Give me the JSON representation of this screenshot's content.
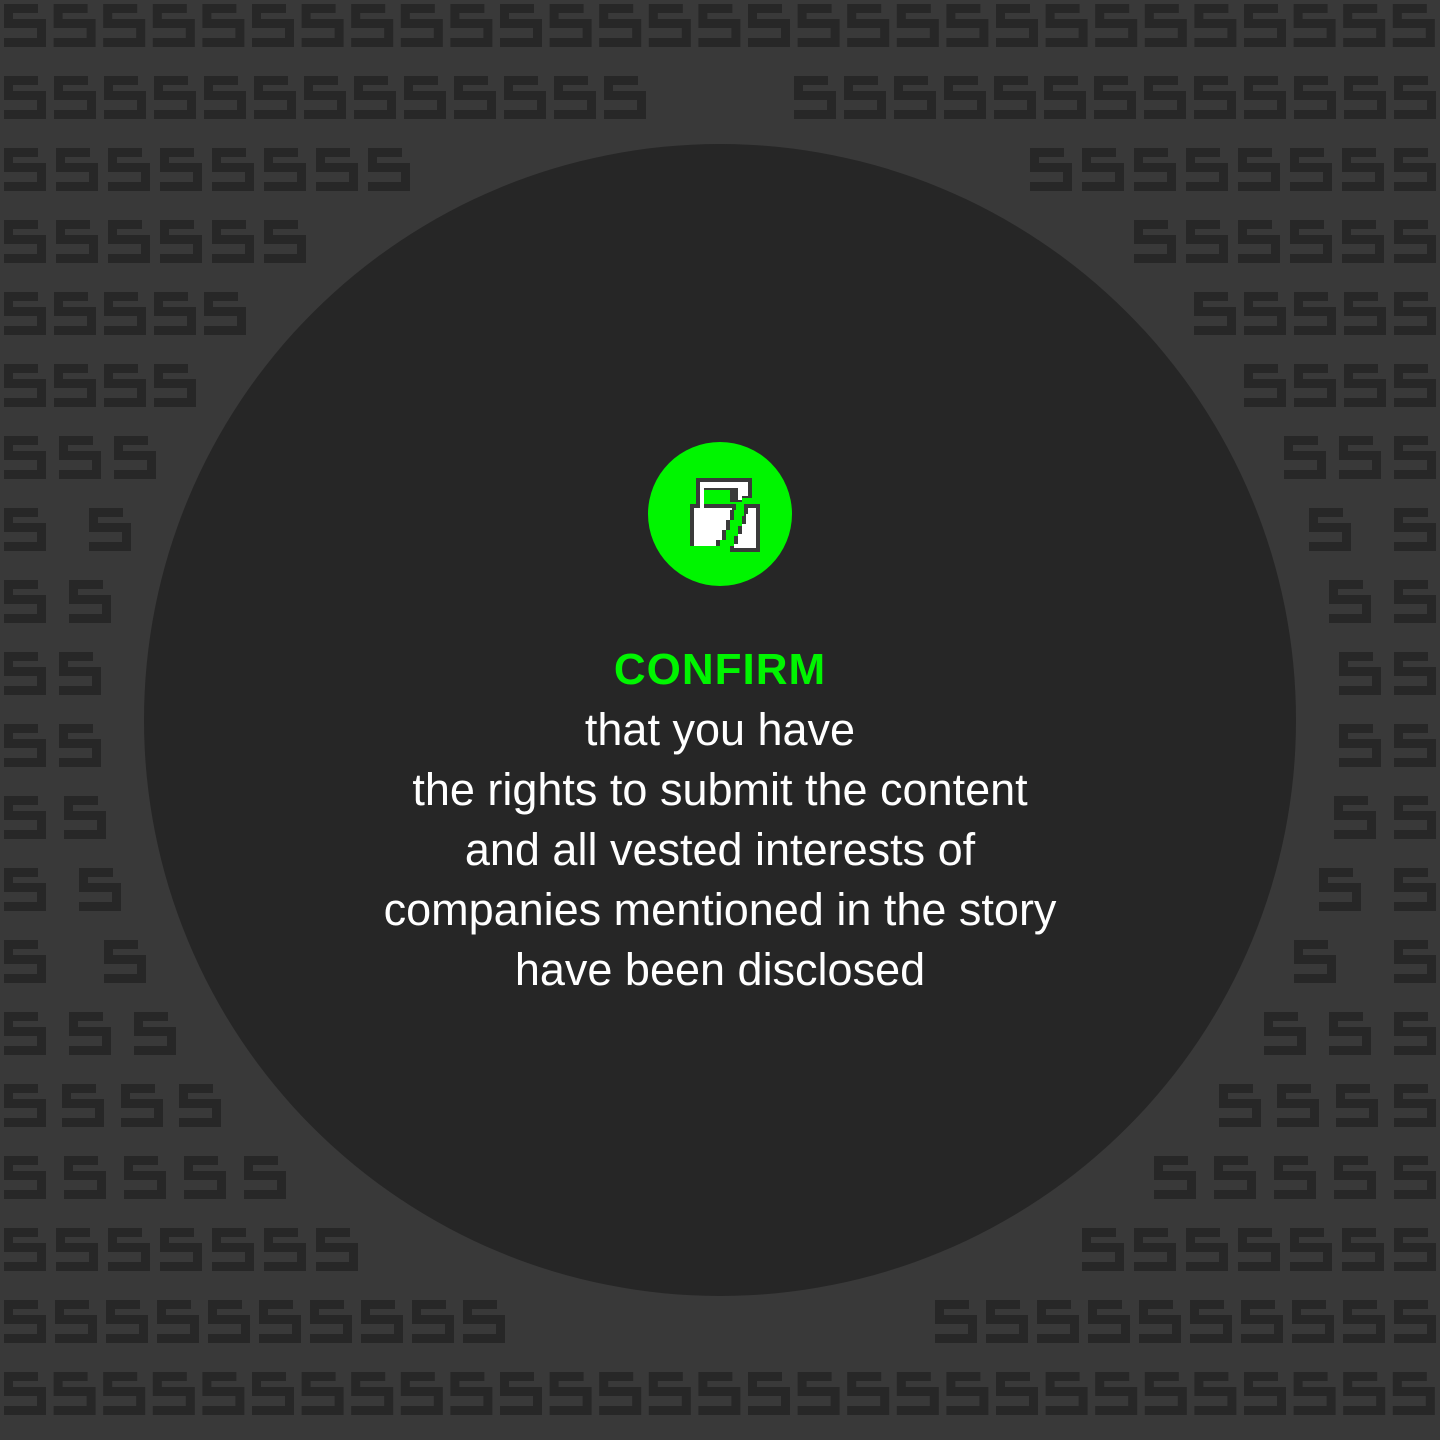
{
  "colors": {
    "background": "#393939",
    "pattern": "#272727",
    "circle": "#262626",
    "accent": "#00f500",
    "text": "#ffffff"
  },
  "background_glyph": "5",
  "icon": "unlocked-padlock-icon",
  "headline": "CONFIRM",
  "body_lines": [
    "that you have",
    "the rights to submit the content",
    "and all vested interests of",
    "companies mentioned in the story",
    "have been disclosed"
  ]
}
